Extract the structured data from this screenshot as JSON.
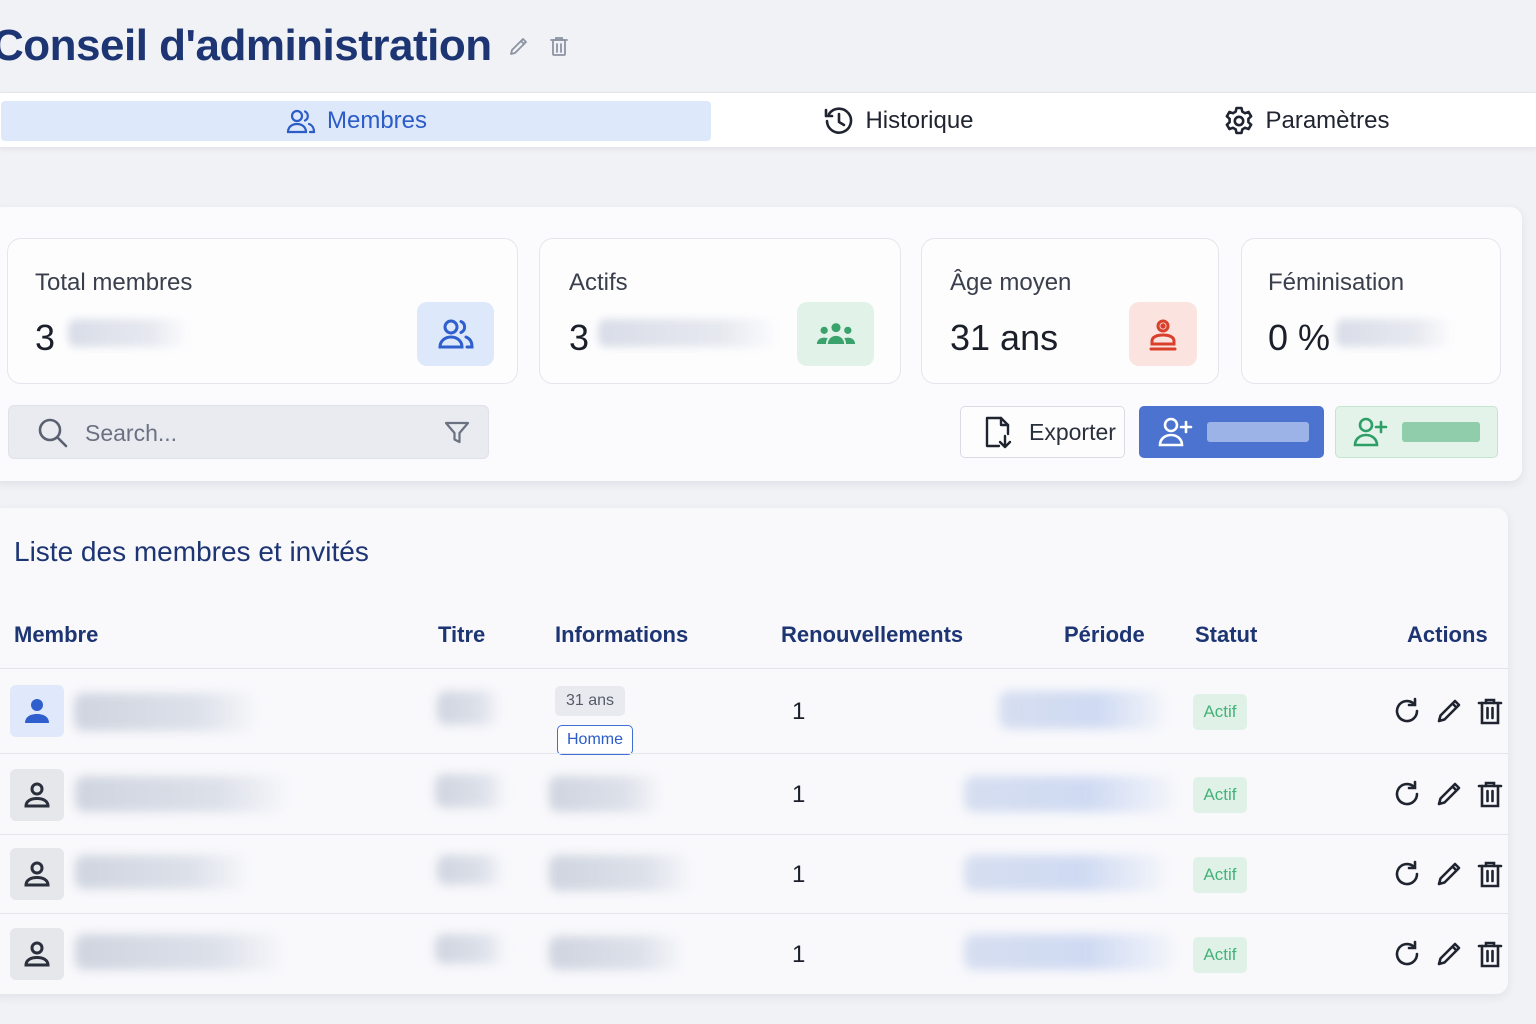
{
  "header": {
    "title": "Conseil d'administration",
    "edit_icon": "pencil-icon",
    "delete_icon": "trash-icon"
  },
  "tabs": [
    {
      "label": "Membres",
      "icon": "users-icon",
      "active": true
    },
    {
      "label": "Historique",
      "icon": "history-icon",
      "active": false
    },
    {
      "label": "Paramètres",
      "icon": "gear-icon",
      "active": false
    }
  ],
  "stats": [
    {
      "label": "Total membres",
      "value": "3",
      "icon": "users-icon",
      "color": "#2f5fcc",
      "bg": "#dde8fa"
    },
    {
      "label": "Actifs",
      "value": "3",
      "icon": "group-icon",
      "color": "#3aa36c",
      "bg": "#e1f3e8"
    },
    {
      "label": "Âge moyen",
      "value": "31 ans",
      "icon": "person-badge-icon",
      "color": "#d9402b",
      "bg": "#fbe3df"
    },
    {
      "label": "Féminisation",
      "value": "0 %"
    }
  ],
  "search": {
    "placeholder": "Search..."
  },
  "actions": {
    "export_label": "Exporter"
  },
  "list": {
    "title": "Liste des membres et invités",
    "columns": [
      "Membre",
      "Titre",
      "Informations",
      "Renouvellements",
      "Période",
      "Statut",
      "Actions"
    ],
    "rows": [
      {
        "age": "31 ans",
        "sex": "Homme",
        "renewals": "1",
        "status": "Actif",
        "highlight": true
      },
      {
        "renewals": "1",
        "status": "Actif",
        "highlight": false
      },
      {
        "renewals": "1",
        "status": "Actif",
        "highlight": false
      },
      {
        "renewals": "1",
        "status": "Actif",
        "highlight": false
      }
    ]
  },
  "colors": {
    "primary": "#4b73cf",
    "title": "#1d3573",
    "success": "#45b27a"
  }
}
